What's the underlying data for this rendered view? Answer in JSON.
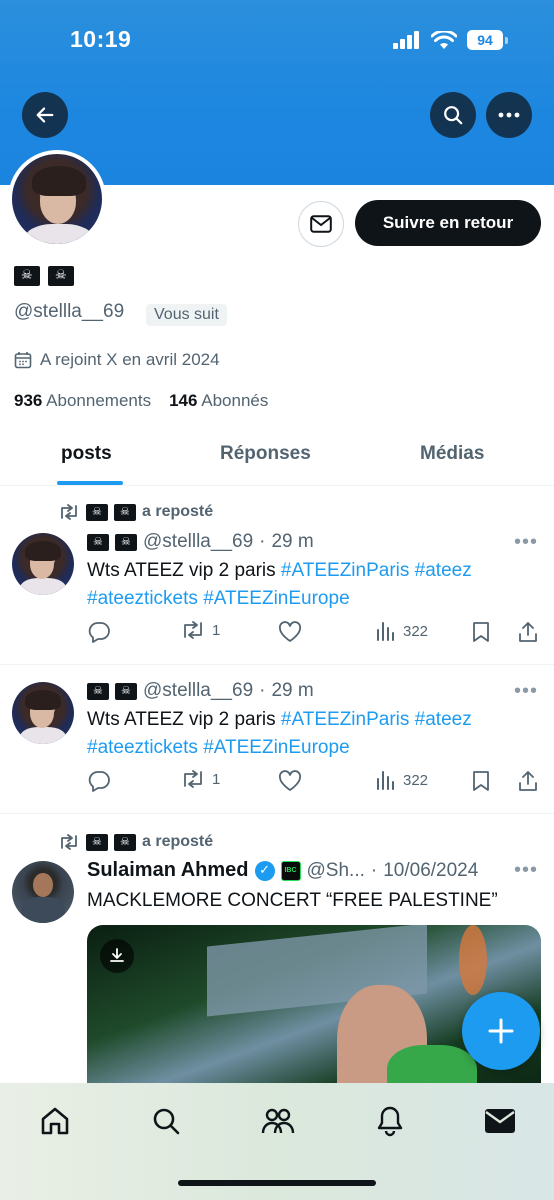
{
  "status_bar": {
    "time": "10:19",
    "battery": "94"
  },
  "profile": {
    "handle": "@stellla__69",
    "follows_you": "Vous suit",
    "joined": "A rejoint X en avril 2024",
    "following_count": "936",
    "following_label": "Abonnements",
    "followers_count": "146",
    "followers_label": "Abonnés",
    "follow_back_label": "Suivre en retour"
  },
  "tabs": [
    "posts",
    "Réponses",
    "Médias"
  ],
  "posts": [
    {
      "repost_label": "a reposté",
      "handle": "@stellla__69",
      "time": "29 m",
      "text": "Wts ATEEZ vip 2 paris",
      "hashtags": [
        "#ATEEZinParis",
        "#ateez",
        "#ateeztickets",
        "#ATEEZinEurope"
      ],
      "reposts": "1",
      "views": "322"
    },
    {
      "handle": "@stellla__69",
      "time": "29 m",
      "text": "Wts ATEEZ vip 2 paris",
      "hashtags": [
        "#ATEEZinParis",
        "#ateez",
        "#ateeztickets",
        "#ATEEZinEurope"
      ],
      "reposts": "1",
      "views": "322"
    },
    {
      "repost_label": "a reposté",
      "author_name": "Sulaiman Ahmed",
      "badge_text": "IBC",
      "handle": "@Sh...",
      "date": "10/06/2024",
      "text": "MACKLEMORE CONCERT “FREE PALESTINE”"
    }
  ],
  "colors": {
    "accent": "#1d9bf0",
    "banner": "#1d87e0",
    "text": "#0f1419",
    "muted": "#536471"
  },
  "icons": [
    "back-arrow-icon",
    "search-icon",
    "more-icon",
    "mail-icon",
    "calendar-icon",
    "repost-icon",
    "reply-icon",
    "like-icon",
    "views-icon",
    "bookmark-icon",
    "share-icon",
    "download-icon",
    "plus-icon",
    "home-icon",
    "communities-icon",
    "bell-icon",
    "messages-icon"
  ]
}
